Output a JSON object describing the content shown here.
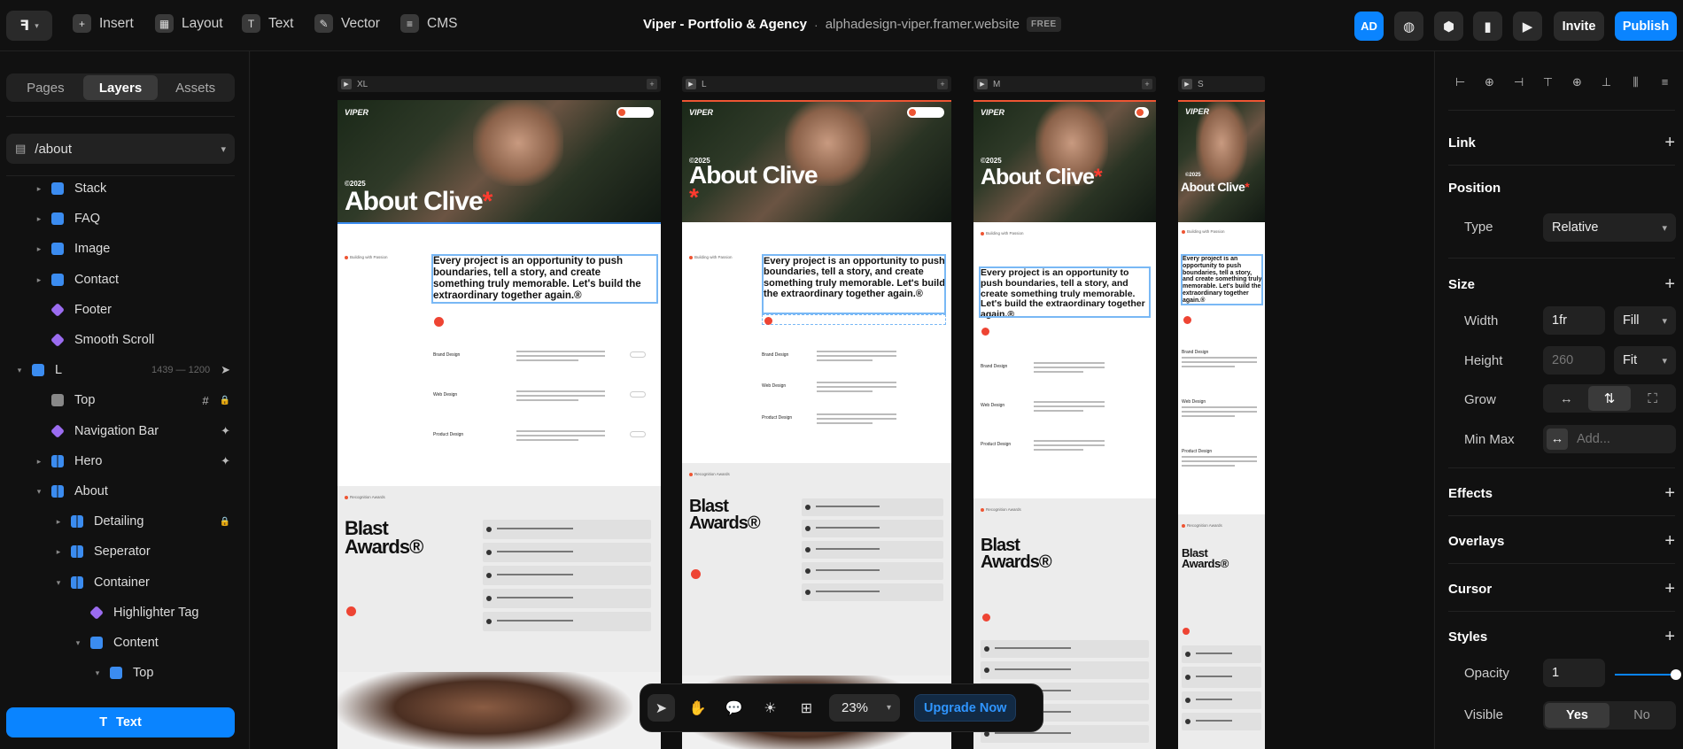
{
  "topbar": {
    "tools": [
      {
        "label": "Insert",
        "icon": "plus-square-icon"
      },
      {
        "label": "Layout",
        "icon": "layout-icon"
      },
      {
        "label": "Text",
        "icon": "text-icon"
      },
      {
        "label": "Vector",
        "icon": "pen-icon"
      },
      {
        "label": "CMS",
        "icon": "database-icon"
      }
    ],
    "project_title": "Viper - Portfolio & Agency",
    "separator": "·",
    "site_url": "alphadesign-viper.framer.website",
    "plan_badge": "FREE",
    "avatar_initials": "AD",
    "invite_label": "Invite",
    "publish_label": "Publish",
    "accent": "#0a84ff"
  },
  "left": {
    "tabs": [
      "Pages",
      "Layers",
      "Assets"
    ],
    "active_tab": "Layers",
    "page_selector": "/about",
    "layers": [
      {
        "label": "Stack",
        "icon": "stack",
        "depth": 1,
        "arrow": "▸"
      },
      {
        "label": "FAQ",
        "icon": "stack",
        "depth": 1,
        "arrow": "▸"
      },
      {
        "label": "Image",
        "icon": "stack",
        "depth": 1,
        "arrow": "▸"
      },
      {
        "label": "Contact",
        "icon": "stack",
        "depth": 1,
        "arrow": "▸"
      },
      {
        "label": "Footer",
        "icon": "component",
        "depth": 1,
        "arrow": ""
      },
      {
        "label": "Smooth Scroll",
        "icon": "component",
        "depth": 1,
        "arrow": ""
      },
      {
        "label": "L",
        "icon": "stack",
        "depth": 0,
        "arrow": "▾",
        "meta": "1439 — 1200"
      },
      {
        "label": "Top",
        "icon": "frame",
        "depth": 1,
        "arrow": ""
      },
      {
        "label": "Navigation Bar",
        "icon": "component",
        "depth": 1,
        "arrow": ""
      },
      {
        "label": "Hero",
        "icon": "columns",
        "depth": 1,
        "arrow": "▸"
      },
      {
        "label": "About",
        "icon": "columns",
        "depth": 1,
        "arrow": "▾"
      },
      {
        "label": "Detailing",
        "icon": "columns",
        "depth": 2,
        "arrow": "▸"
      },
      {
        "label": "Seperator",
        "icon": "columns",
        "depth": 2,
        "arrow": "▸"
      },
      {
        "label": "Container",
        "icon": "columns",
        "depth": 2,
        "arrow": "▾"
      },
      {
        "label": "Highlighter Tag",
        "icon": "component",
        "depth": 3,
        "arrow": ""
      },
      {
        "label": "Content",
        "icon": "stack",
        "depth": 3,
        "arrow": "▾"
      },
      {
        "label": "Top",
        "icon": "stack",
        "depth": 4,
        "arrow": "▾"
      }
    ],
    "selected_layer": "Text"
  },
  "canvas": {
    "breakpoints": [
      "XL",
      "L",
      "M",
      "S"
    ],
    "site_brand": "VIPER",
    "hero_heading": "About Clive",
    "hero_star": "*",
    "hero_year": "©2025",
    "tagline": "Building with Passion",
    "intro_text": "Every project is an opportunity to push boundaries, tell a story, and create something truly memorable. Let's build the extraordinary together again.®",
    "services": [
      "Brand Design",
      "Web Design",
      "Product Design"
    ],
    "awards_tag": "Recognition Awards",
    "awards_heading_1": "Blast",
    "awards_heading_2": "Awards®"
  },
  "bottom_toolbar": {
    "zoom": "23%",
    "upgrade_label": "Upgrade Now"
  },
  "right": {
    "sections": {
      "link": "Link",
      "position": "Position",
      "size": "Size",
      "effects": "Effects",
      "overlays": "Overlays",
      "cursor": "Cursor",
      "styles": "Styles"
    },
    "type_label": "Type",
    "type_value": "Relative",
    "width_label": "Width",
    "width_value": "1fr",
    "width_mode": "Fill",
    "height_label": "Height",
    "height_value": "260",
    "height_mode": "Fit",
    "grow_label": "Grow",
    "minmax_label": "Min Max",
    "minmax_placeholder": "Add...",
    "opacity_label": "Opacity",
    "opacity_value": "1",
    "opacity_level": 1,
    "visible_label": "Visible",
    "visible_yes": "Yes",
    "visible_no": "No"
  }
}
